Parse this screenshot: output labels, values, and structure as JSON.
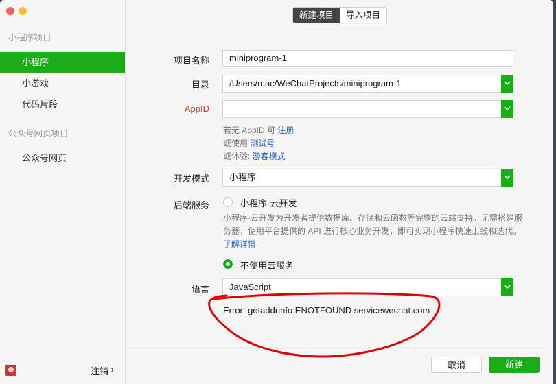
{
  "sidebar": {
    "section_miniprogram": "小程序项目",
    "items_miniprogram": [
      {
        "label": "小程序",
        "active": true
      },
      {
        "label": "小游戏",
        "active": false
      },
      {
        "label": "代码片段",
        "active": false
      }
    ],
    "section_official": "公众号网页项目",
    "items_official": [
      {
        "label": "公众号网页",
        "active": false
      }
    ],
    "logout_label": "注销",
    "logout_arrow": "›"
  },
  "header": {
    "tab_new": "新建项目",
    "tab_import": "导入项目"
  },
  "form": {
    "project_name_label": "项目名称",
    "project_name_value": "miniprogram-1",
    "directory_label": "目录",
    "directory_value": "/Users/mac/WeChatProjects/miniprogram-1",
    "appid_label": "AppID",
    "appid_value": "",
    "hint1_prefix": "若无 AppID 可 ",
    "hint1_link": "注册",
    "hint2_prefix": "或使用 ",
    "hint2_link": "测试号",
    "hint3_prefix": "或体验:  ",
    "hint3_link": "游客模式",
    "dev_mode_label": "开发模式",
    "dev_mode_value": "小程序",
    "backend_label": "后端服务",
    "cloud_option": "小程序·云开发",
    "cloud_desc": "小程序·云开发为开发者提供数据库、存储和云函数等完整的云端支持。无需搭建服务器，使用平台提供的 API 进行核心业务开发，即可实现小程序快速上线和迭代。",
    "cloud_learn_more": "了解详情",
    "no_cloud_option": "不使用云服务",
    "language_label": "语言",
    "language_value": "JavaScript",
    "error_text": "Error: getaddrinfo ENOTFOUND servicewechat.com"
  },
  "footer": {
    "cancel_label": "取消",
    "create_label": "新建"
  },
  "colors": {
    "accent": "#1aad19",
    "link": "#1f5fcf",
    "required": "#d0332a",
    "annotation": "#e00000"
  }
}
